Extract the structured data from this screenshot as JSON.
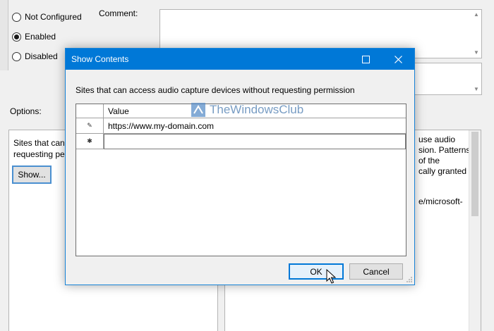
{
  "policy": {
    "radios": [
      {
        "label": "Not Configured",
        "checked": false
      },
      {
        "label": "Enabled",
        "checked": true
      },
      {
        "label": "Disabled",
        "checked": false
      }
    ],
    "comment_label": "Comment:",
    "options_label": "Options:",
    "options_text_line1": "Sites that can",
    "options_text_line2": "requesting pe",
    "show_button": "Show...",
    "help_text": "use audio\nsion. Patterns\nof the\ncally granted",
    "help_text2": "e/microsoft-"
  },
  "dialog": {
    "title": "Show Contents",
    "description": "Sites that can access audio capture devices without requesting permission",
    "column_header": "Value",
    "rows": [
      {
        "marker": "✎",
        "value": "https://www.my-domain.com"
      },
      {
        "marker": "✱",
        "value": ""
      }
    ],
    "ok_label": "OK",
    "cancel_label": "Cancel",
    "watermark": "TheWindowsClub"
  },
  "colors": {
    "titlebar": "#0078d7",
    "accent": "#0078d7"
  }
}
